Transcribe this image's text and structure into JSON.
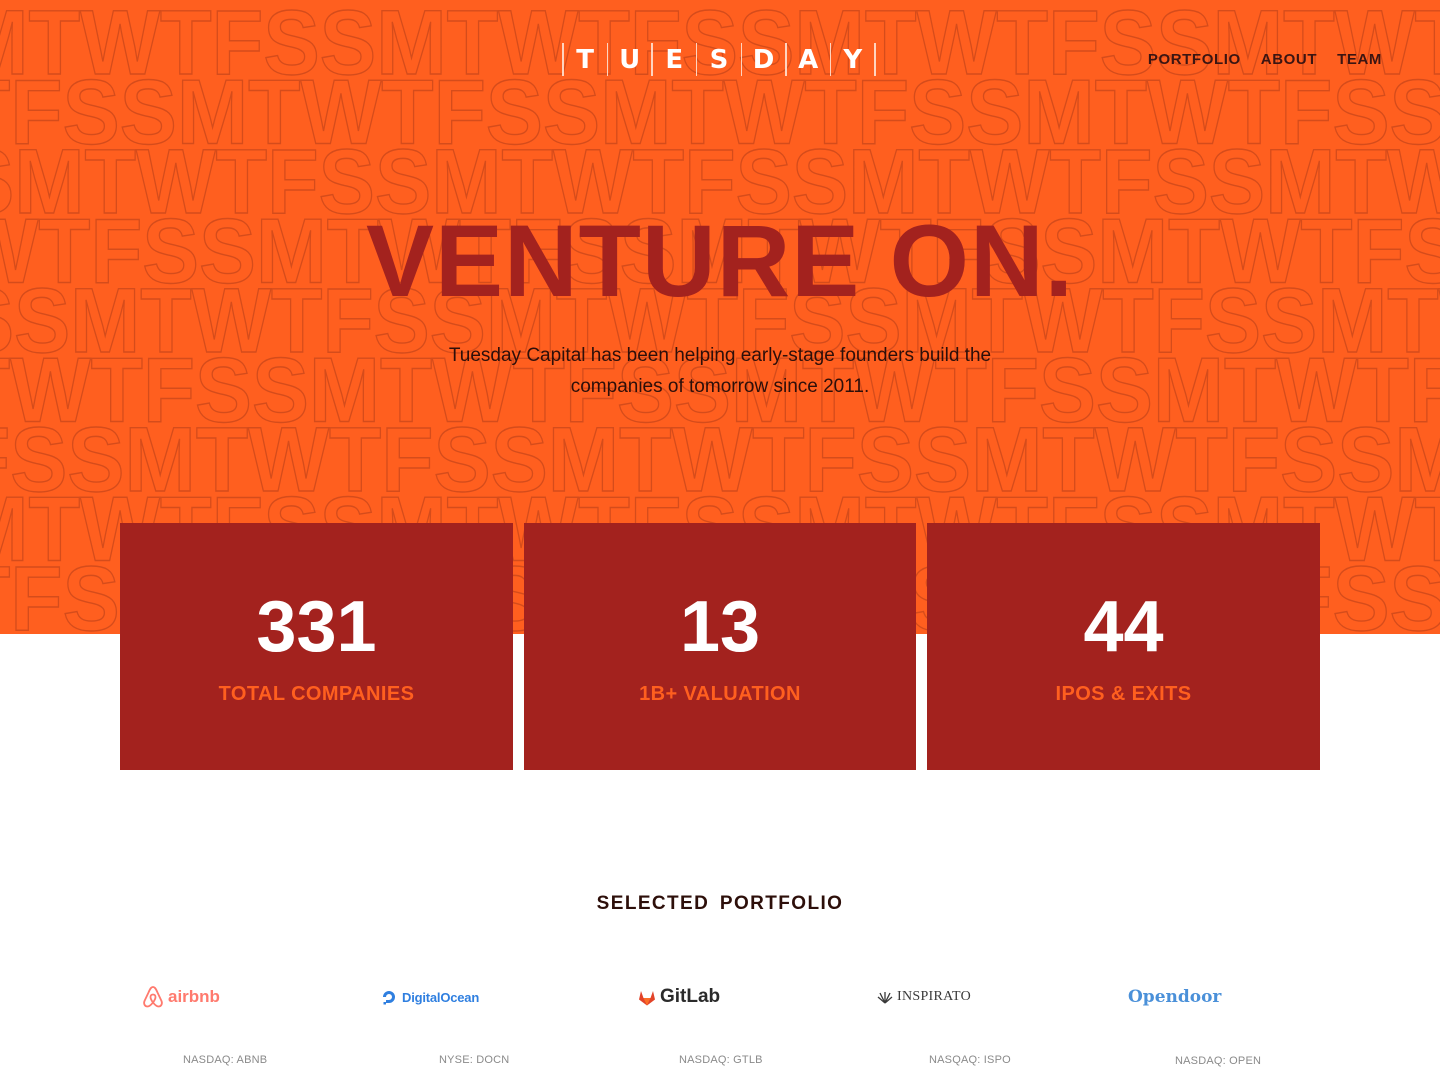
{
  "header": {
    "logo_letters": [
      "T",
      "U",
      "E",
      "S",
      "D",
      "A",
      "Y"
    ],
    "nav": [
      {
        "label": "PORTFOLIO"
      },
      {
        "label": "ABOUT"
      },
      {
        "label": "TEAM"
      }
    ]
  },
  "hero": {
    "headline": "VENTURE ON.",
    "subtitle": "Tuesday Capital has been helping early-stage founders build the companies of tomorrow since 2011.",
    "background_pattern": "MTWTFSS"
  },
  "stats": [
    {
      "value": "331",
      "label": "TOTAL COMPANIES"
    },
    {
      "value": "13",
      "label": "1B+ VALUATION"
    },
    {
      "value": "44",
      "label": "IPOS & EXITS"
    }
  ],
  "portfolio": {
    "title": "SELECTED PORTFOLIO",
    "companies": [
      {
        "name": "airbnb",
        "ticker": "NASDAQ: ABNB",
        "icon": "airbnb-logo-icon"
      },
      {
        "name": "DigitalOcean",
        "ticker": "NYSE: DOCN",
        "icon": "digitalocean-logo-icon"
      },
      {
        "name": "GitLab",
        "ticker": "NASDAQ: GTLB",
        "icon": "gitlab-logo-icon"
      },
      {
        "name": "INSPIRATO",
        "ticker": "NASQAQ: ISPO",
        "icon": "inspirato-logo-icon"
      },
      {
        "name": "Opendoor",
        "ticker": "NASDAQ: OPEN",
        "icon": "opendoor-logo-icon"
      }
    ]
  },
  "colors": {
    "hero_bg": "#ff5f1f",
    "accent_dark": "#a3221e",
    "text_dark": "#2d0f0a",
    "white": "#ffffff"
  }
}
